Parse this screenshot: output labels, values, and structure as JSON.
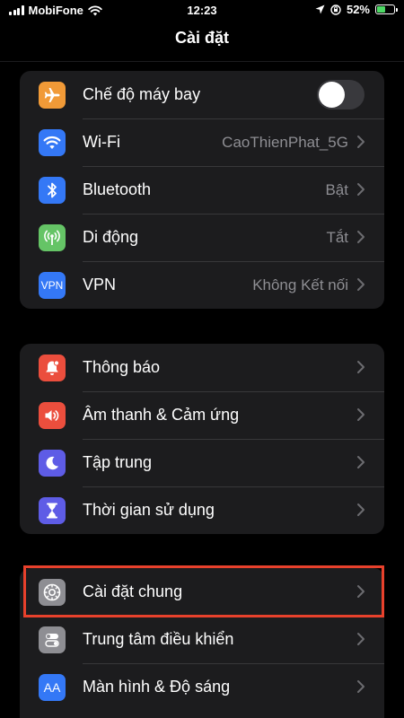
{
  "status_bar": {
    "carrier": "MobiFone",
    "time": "12:23",
    "battery_percent": "52%",
    "battery_level": 0.52
  },
  "nav": {
    "title": "Cài đặt"
  },
  "groups": [
    {
      "rows": [
        {
          "label": "Chế độ máy bay",
          "icon": "airplane-icon",
          "color": "#f19a37",
          "toggle": false
        },
        {
          "label": "Wi-Fi",
          "value": "CaoThienPhat_5G",
          "icon": "wifi-icon",
          "color": "#3478f6"
        },
        {
          "label": "Bluetooth",
          "value": "Bật",
          "icon": "bluetooth-icon",
          "color": "#3478f6"
        },
        {
          "label": "Di động",
          "value": "Tắt",
          "icon": "antenna-icon",
          "color": "#65c466"
        },
        {
          "label": "VPN",
          "value": "Không Kết nối",
          "icon": "vpn-icon",
          "icon_text": "VPN",
          "color": "#3478f6"
        }
      ]
    },
    {
      "rows": [
        {
          "label": "Thông báo",
          "icon": "bell-icon",
          "color": "#eb4e3d"
        },
        {
          "label": "Âm thanh & Cảm ứng",
          "icon": "speaker-icon",
          "color": "#eb4e3d"
        },
        {
          "label": "Tập trung",
          "icon": "moon-icon",
          "color": "#5e5ce6"
        },
        {
          "label": "Thời gian sử dụng",
          "icon": "hourglass-icon",
          "color": "#5e5ce6"
        }
      ]
    },
    {
      "rows": [
        {
          "label": "Cài đặt chung",
          "icon": "gear-icon",
          "color": "#8e8e93"
        },
        {
          "label": "Trung tâm điều khiển",
          "icon": "toggles-icon",
          "color": "#8e8e93"
        },
        {
          "label": "Màn hình & Độ sáng",
          "icon": "text-size-icon",
          "icon_text": "AA",
          "color": "#3478f6"
        }
      ]
    }
  ]
}
